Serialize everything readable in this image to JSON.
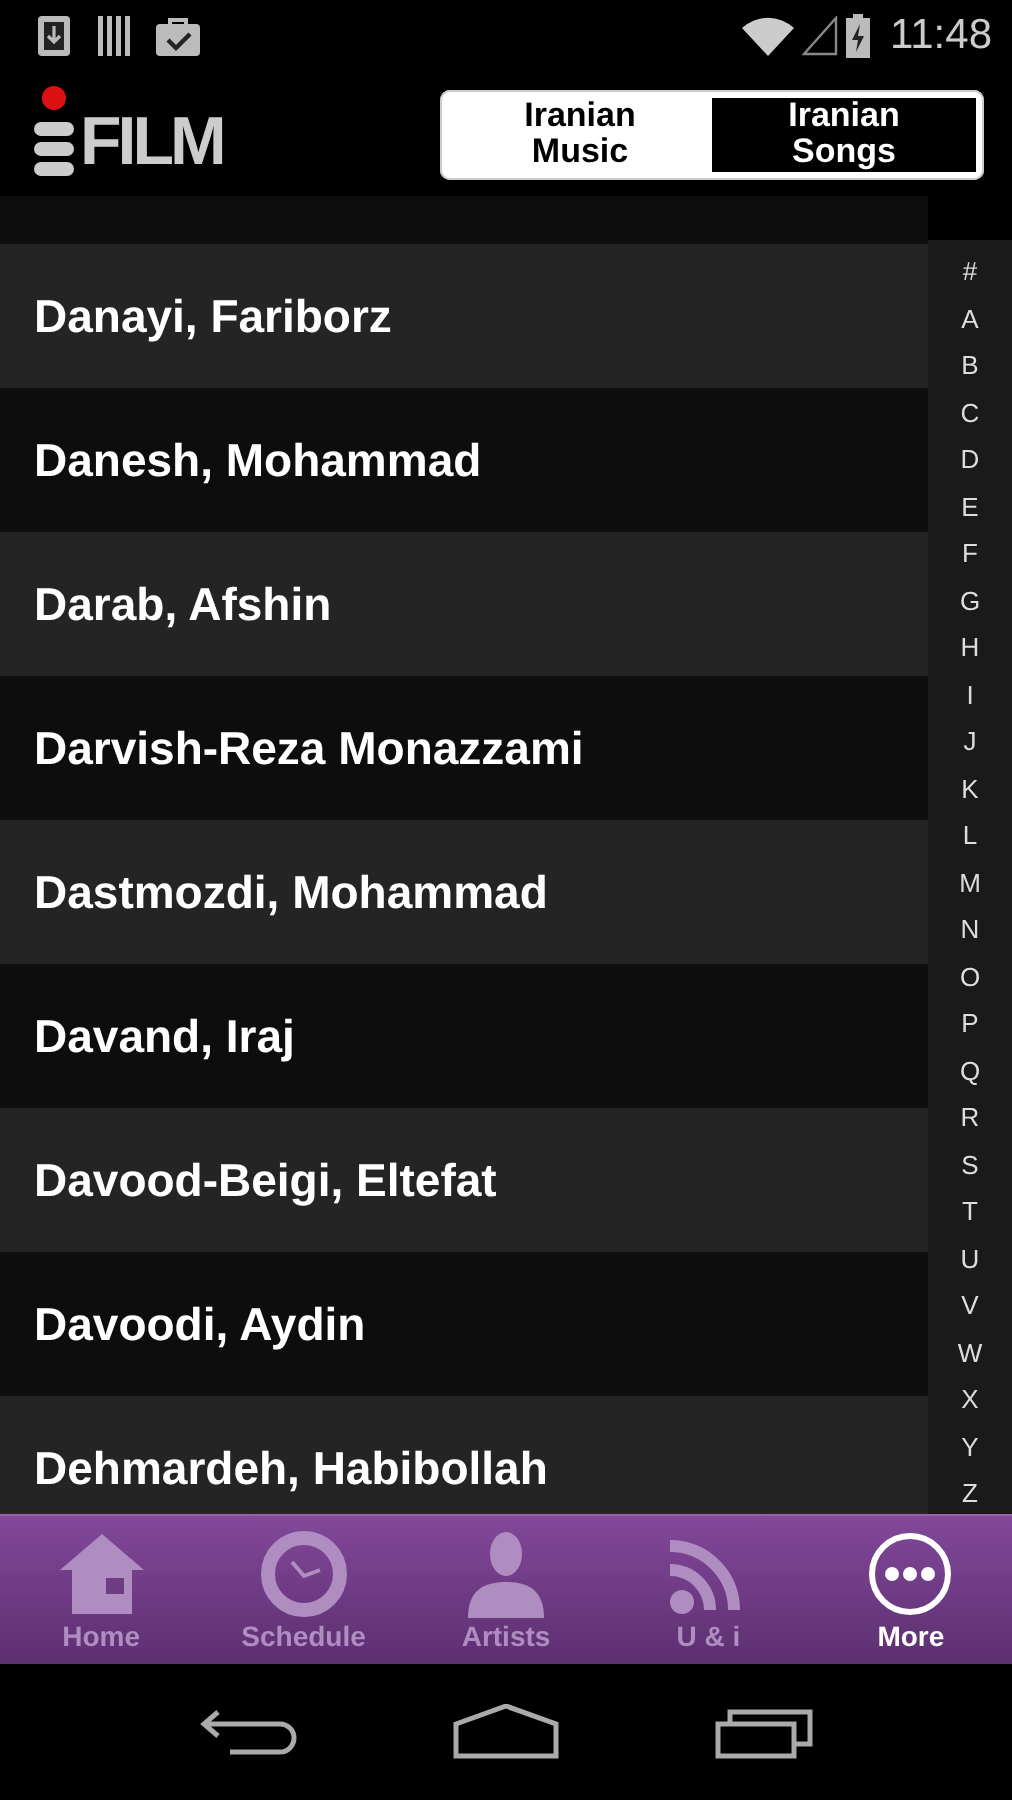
{
  "status_bar": {
    "time": "11:48"
  },
  "header": {
    "logo": "FILM",
    "tabs": [
      {
        "label": "Iranian Music",
        "selected": false
      },
      {
        "label": "Iranian Songs",
        "selected": true
      }
    ]
  },
  "artists": [
    "Danayi, Fariborz",
    "Danesh, Mohammad",
    "Darab, Afshin",
    "Darvish-Reza Monazzami",
    "Dastmozdi, Mohammad",
    "Davand, Iraj",
    "Davood-Beigi, Eltefat",
    "Davoodi, Aydin",
    "Dehmardeh, Habibollah"
  ],
  "index": [
    "#",
    "A",
    "B",
    "C",
    "D",
    "E",
    "F",
    "G",
    "H",
    "I",
    "J",
    "K",
    "L",
    "M",
    "N",
    "O",
    "P",
    "Q",
    "R",
    "S",
    "T",
    "U",
    "V",
    "W",
    "X",
    "Y",
    "Z"
  ],
  "bottom_nav": [
    {
      "kind": "home",
      "label": "Home",
      "selected": false
    },
    {
      "kind": "schedule",
      "label": "Schedule",
      "selected": false
    },
    {
      "kind": "artists",
      "label": "Artists",
      "selected": false
    },
    {
      "kind": "feed",
      "label": "U & i",
      "selected": false
    },
    {
      "kind": "more",
      "label": "More",
      "selected": true
    }
  ]
}
